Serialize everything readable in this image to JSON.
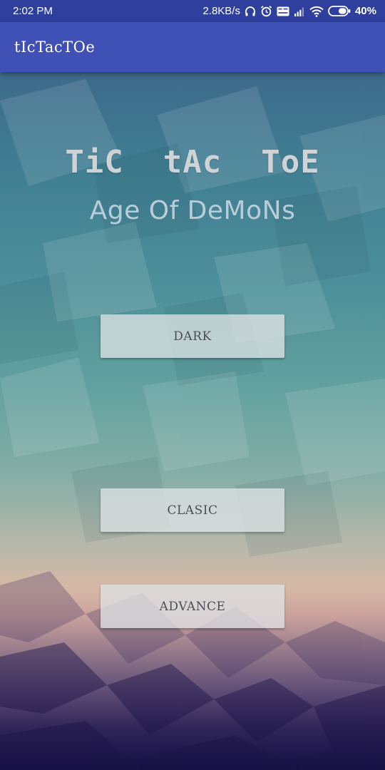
{
  "status_bar": {
    "time": "2:02 PM",
    "network_speed": "2.8KB/s",
    "battery": "40%",
    "icons": [
      "headphones-icon",
      "alarm-icon",
      "volte-icon",
      "signal-icon",
      "wifi-icon",
      "battery-icon"
    ]
  },
  "app_bar": {
    "title": "tIcTacTOe"
  },
  "main": {
    "title": "TiC  tAc  ToE",
    "subtitle": "Age Of DeMoNs",
    "buttons": [
      {
        "label": "DARK"
      },
      {
        "label": "CLASIC"
      },
      {
        "label": "ADVANCE"
      }
    ]
  },
  "colors": {
    "status_bar": "#2f3f9e",
    "app_bar": "#3f51b5",
    "title_text": "#cfd3d6",
    "subtitle_text": "#b9cdd8",
    "button_bg": "#dee2e4",
    "button_text": "#4a4f55"
  }
}
